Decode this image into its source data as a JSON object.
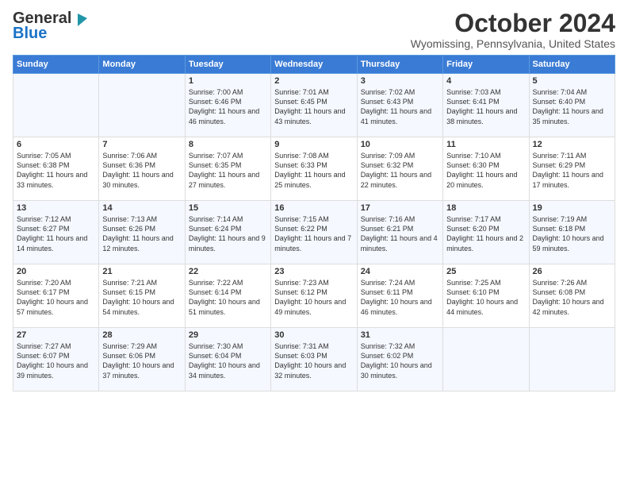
{
  "logo": {
    "line1": "General",
    "line2": "Blue"
  },
  "header": {
    "month": "October 2024",
    "location": "Wyomissing, Pennsylvania, United States"
  },
  "days_of_week": [
    "Sunday",
    "Monday",
    "Tuesday",
    "Wednesday",
    "Thursday",
    "Friday",
    "Saturday"
  ],
  "weeks": [
    [
      {
        "day": "",
        "sunrise": "",
        "sunset": "",
        "daylight": ""
      },
      {
        "day": "",
        "sunrise": "",
        "sunset": "",
        "daylight": ""
      },
      {
        "day": "1",
        "sunrise": "Sunrise: 7:00 AM",
        "sunset": "Sunset: 6:46 PM",
        "daylight": "Daylight: 11 hours and 46 minutes."
      },
      {
        "day": "2",
        "sunrise": "Sunrise: 7:01 AM",
        "sunset": "Sunset: 6:45 PM",
        "daylight": "Daylight: 11 hours and 43 minutes."
      },
      {
        "day": "3",
        "sunrise": "Sunrise: 7:02 AM",
        "sunset": "Sunset: 6:43 PM",
        "daylight": "Daylight: 11 hours and 41 minutes."
      },
      {
        "day": "4",
        "sunrise": "Sunrise: 7:03 AM",
        "sunset": "Sunset: 6:41 PM",
        "daylight": "Daylight: 11 hours and 38 minutes."
      },
      {
        "day": "5",
        "sunrise": "Sunrise: 7:04 AM",
        "sunset": "Sunset: 6:40 PM",
        "daylight": "Daylight: 11 hours and 35 minutes."
      }
    ],
    [
      {
        "day": "6",
        "sunrise": "Sunrise: 7:05 AM",
        "sunset": "Sunset: 6:38 PM",
        "daylight": "Daylight: 11 hours and 33 minutes."
      },
      {
        "day": "7",
        "sunrise": "Sunrise: 7:06 AM",
        "sunset": "Sunset: 6:36 PM",
        "daylight": "Daylight: 11 hours and 30 minutes."
      },
      {
        "day": "8",
        "sunrise": "Sunrise: 7:07 AM",
        "sunset": "Sunset: 6:35 PM",
        "daylight": "Daylight: 11 hours and 27 minutes."
      },
      {
        "day": "9",
        "sunrise": "Sunrise: 7:08 AM",
        "sunset": "Sunset: 6:33 PM",
        "daylight": "Daylight: 11 hours and 25 minutes."
      },
      {
        "day": "10",
        "sunrise": "Sunrise: 7:09 AM",
        "sunset": "Sunset: 6:32 PM",
        "daylight": "Daylight: 11 hours and 22 minutes."
      },
      {
        "day": "11",
        "sunrise": "Sunrise: 7:10 AM",
        "sunset": "Sunset: 6:30 PM",
        "daylight": "Daylight: 11 hours and 20 minutes."
      },
      {
        "day": "12",
        "sunrise": "Sunrise: 7:11 AM",
        "sunset": "Sunset: 6:29 PM",
        "daylight": "Daylight: 11 hours and 17 minutes."
      }
    ],
    [
      {
        "day": "13",
        "sunrise": "Sunrise: 7:12 AM",
        "sunset": "Sunset: 6:27 PM",
        "daylight": "Daylight: 11 hours and 14 minutes."
      },
      {
        "day": "14",
        "sunrise": "Sunrise: 7:13 AM",
        "sunset": "Sunset: 6:26 PM",
        "daylight": "Daylight: 11 hours and 12 minutes."
      },
      {
        "day": "15",
        "sunrise": "Sunrise: 7:14 AM",
        "sunset": "Sunset: 6:24 PM",
        "daylight": "Daylight: 11 hours and 9 minutes."
      },
      {
        "day": "16",
        "sunrise": "Sunrise: 7:15 AM",
        "sunset": "Sunset: 6:22 PM",
        "daylight": "Daylight: 11 hours and 7 minutes."
      },
      {
        "day": "17",
        "sunrise": "Sunrise: 7:16 AM",
        "sunset": "Sunset: 6:21 PM",
        "daylight": "Daylight: 11 hours and 4 minutes."
      },
      {
        "day": "18",
        "sunrise": "Sunrise: 7:17 AM",
        "sunset": "Sunset: 6:20 PM",
        "daylight": "Daylight: 11 hours and 2 minutes."
      },
      {
        "day": "19",
        "sunrise": "Sunrise: 7:19 AM",
        "sunset": "Sunset: 6:18 PM",
        "daylight": "Daylight: 10 hours and 59 minutes."
      }
    ],
    [
      {
        "day": "20",
        "sunrise": "Sunrise: 7:20 AM",
        "sunset": "Sunset: 6:17 PM",
        "daylight": "Daylight: 10 hours and 57 minutes."
      },
      {
        "day": "21",
        "sunrise": "Sunrise: 7:21 AM",
        "sunset": "Sunset: 6:15 PM",
        "daylight": "Daylight: 10 hours and 54 minutes."
      },
      {
        "day": "22",
        "sunrise": "Sunrise: 7:22 AM",
        "sunset": "Sunset: 6:14 PM",
        "daylight": "Daylight: 10 hours and 51 minutes."
      },
      {
        "day": "23",
        "sunrise": "Sunrise: 7:23 AM",
        "sunset": "Sunset: 6:12 PM",
        "daylight": "Daylight: 10 hours and 49 minutes."
      },
      {
        "day": "24",
        "sunrise": "Sunrise: 7:24 AM",
        "sunset": "Sunset: 6:11 PM",
        "daylight": "Daylight: 10 hours and 46 minutes."
      },
      {
        "day": "25",
        "sunrise": "Sunrise: 7:25 AM",
        "sunset": "Sunset: 6:10 PM",
        "daylight": "Daylight: 10 hours and 44 minutes."
      },
      {
        "day": "26",
        "sunrise": "Sunrise: 7:26 AM",
        "sunset": "Sunset: 6:08 PM",
        "daylight": "Daylight: 10 hours and 42 minutes."
      }
    ],
    [
      {
        "day": "27",
        "sunrise": "Sunrise: 7:27 AM",
        "sunset": "Sunset: 6:07 PM",
        "daylight": "Daylight: 10 hours and 39 minutes."
      },
      {
        "day": "28",
        "sunrise": "Sunrise: 7:29 AM",
        "sunset": "Sunset: 6:06 PM",
        "daylight": "Daylight: 10 hours and 37 minutes."
      },
      {
        "day": "29",
        "sunrise": "Sunrise: 7:30 AM",
        "sunset": "Sunset: 6:04 PM",
        "daylight": "Daylight: 10 hours and 34 minutes."
      },
      {
        "day": "30",
        "sunrise": "Sunrise: 7:31 AM",
        "sunset": "Sunset: 6:03 PM",
        "daylight": "Daylight: 10 hours and 32 minutes."
      },
      {
        "day": "31",
        "sunrise": "Sunrise: 7:32 AM",
        "sunset": "Sunset: 6:02 PM",
        "daylight": "Daylight: 10 hours and 30 minutes."
      },
      {
        "day": "",
        "sunrise": "",
        "sunset": "",
        "daylight": ""
      },
      {
        "day": "",
        "sunrise": "",
        "sunset": "",
        "daylight": ""
      }
    ]
  ]
}
